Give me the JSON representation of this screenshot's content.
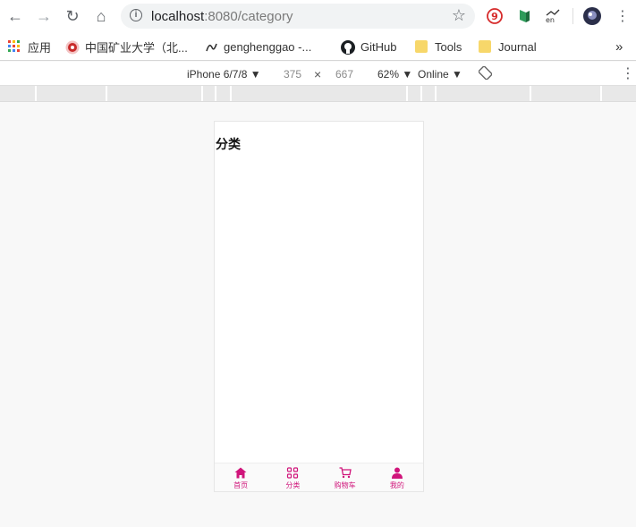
{
  "browser": {
    "url_host": "localhost",
    "url_rest": ":8080/category",
    "nav": {
      "back": "←",
      "forward": "→",
      "reload": "↻",
      "home": "⌂"
    },
    "extensions": [
      "ext-9-icon",
      "ext-green-icon",
      "ext-en-icon",
      "avatar-icon"
    ]
  },
  "bookmarks": {
    "apps_label": "应用",
    "items": [
      {
        "label": "中国矿业大学（北...",
        "icon": "university-icon"
      },
      {
        "label": "genghenggao -...",
        "icon": "custom-icon"
      },
      {
        "label": "GitHub",
        "icon": "github-icon"
      },
      {
        "label": "Tools",
        "icon": "folder-icon"
      },
      {
        "label": "Journal",
        "icon": "folder-icon"
      }
    ],
    "more": "»"
  },
  "devtools": {
    "device": "iPhone 6/7/8",
    "width": "375",
    "times": "×",
    "height": "667",
    "zoom": "62%",
    "network": "Online"
  },
  "page": {
    "title": "分类",
    "tabs": [
      {
        "label": "首页",
        "icon": "home-icon"
      },
      {
        "label": "分类",
        "icon": "category-icon"
      },
      {
        "label": "购物车",
        "icon": "cart-icon"
      },
      {
        "label": "我的",
        "icon": "user-icon"
      }
    ],
    "accent": "#d0157b"
  }
}
